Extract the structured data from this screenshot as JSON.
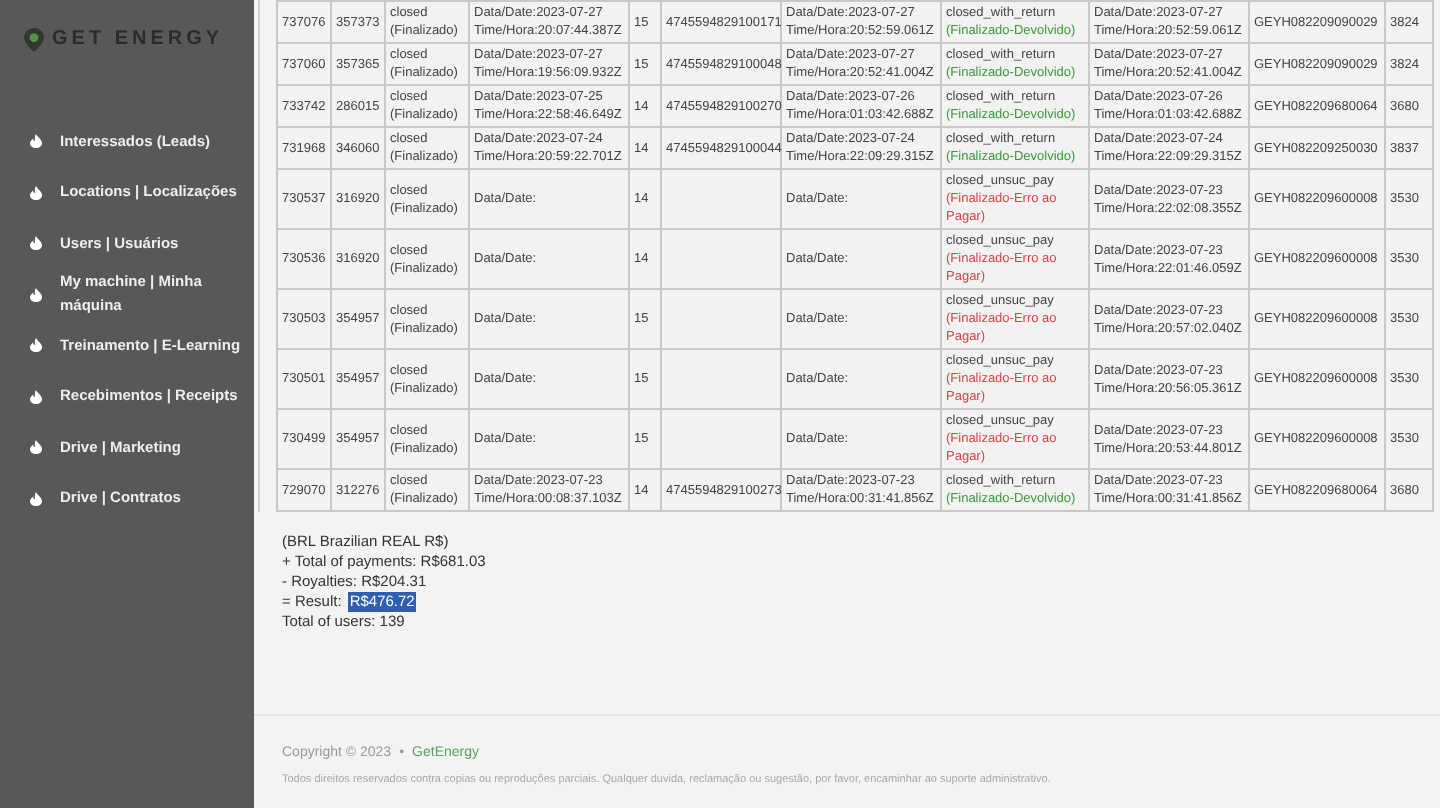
{
  "sidebar": {
    "logo": "GET ENERGY",
    "items": [
      {
        "label": "Interessados (Leads)"
      },
      {
        "label": "Locations | Localizações"
      },
      {
        "label": "Users | Usuários"
      },
      {
        "label": "My machine | Minha máquina"
      },
      {
        "label": "Treinamento | E-Learning"
      },
      {
        "label": "Recebimentos | Receipts"
      },
      {
        "label": "Drive | Marketing"
      },
      {
        "label": "Drive | Contratos"
      }
    ]
  },
  "table": {
    "rows": [
      {
        "id": "737076",
        "user": "357373",
        "status": "closed",
        "status_label": "(Finalizado)",
        "date": [
          "Data/Date:2023-07-27",
          "Time/Hora:20:07:44.387Z"
        ],
        "count": "15",
        "card": "4745594829100171",
        "date_2": [
          "Data/Date:2023-07-27",
          "Time/Hora:20:52:59.061Z"
        ],
        "result": {
          "kind": "returned",
          "code": "closed_with_return",
          "label": "(Finalizado-Devolvido)"
        },
        "date_3": [
          "Data/Date:2023-07-27",
          "Time/Hora:20:52:59.061Z"
        ],
        "serial": "GEYH082209090029",
        "column_11": "3824"
      },
      {
        "id": "737060",
        "user": "357365",
        "status": "closed",
        "status_label": "(Finalizado)",
        "date": [
          "Data/Date:2023-07-27",
          "Time/Hora:19:56:09.932Z"
        ],
        "count": "15",
        "card": "4745594829100048",
        "date_2": [
          "Data/Date:2023-07-27",
          "Time/Hora:20:52:41.004Z"
        ],
        "result": {
          "kind": "returned",
          "code": "closed_with_return",
          "label": "(Finalizado-Devolvido)"
        },
        "date_3": [
          "Data/Date:2023-07-27",
          "Time/Hora:20:52:41.004Z"
        ],
        "serial": "GEYH082209090029",
        "column_11": "3824"
      },
      {
        "id": "733742",
        "user": "286015",
        "status": "closed",
        "status_label": "(Finalizado)",
        "date": [
          "Data/Date:2023-07-25",
          "Time/Hora:22:58:46.649Z"
        ],
        "count": "14",
        "card": "4745594829100270",
        "date_2": [
          "Data/Date:2023-07-26",
          "Time/Hora:01:03:42.688Z"
        ],
        "result": {
          "kind": "returned",
          "code": "closed_with_return",
          "label": "(Finalizado-Devolvido)"
        },
        "date_3": [
          "Data/Date:2023-07-26",
          "Time/Hora:01:03:42.688Z"
        ],
        "serial": "GEYH082209680064",
        "column_11": "3680"
      },
      {
        "id": "731968",
        "user": "346060",
        "status": "closed",
        "status_label": "(Finalizado)",
        "date": [
          "Data/Date:2023-07-24",
          "Time/Hora:20:59:22.701Z"
        ],
        "count": "14",
        "card": "4745594829100044",
        "date_2": [
          "Data/Date:2023-07-24",
          "Time/Hora:22:09:29.315Z"
        ],
        "result": {
          "kind": "returned",
          "code": "closed_with_return",
          "label": "(Finalizado-Devolvido)"
        },
        "date_3": [
          "Data/Date:2023-07-24",
          "Time/Hora:22:09:29.315Z"
        ],
        "serial": "GEYH082209250030",
        "column_11": "3837"
      },
      {
        "id": "730537",
        "user": "316920",
        "status": "closed",
        "status_label": "(Finalizado)",
        "date": [
          "Data/Date:"
        ],
        "count": "14",
        "date_2": [
          "Data/Date:"
        ],
        "result": {
          "kind": "failed",
          "code": "closed_unsuc_pay",
          "label": "(Finalizado-Erro ao Pagar)"
        },
        "date_3": [
          "Data/Date:2023-07-23",
          "Time/Hora:22:02:08.355Z"
        ],
        "serial": "GEYH082209600008",
        "column_11": "3530"
      },
      {
        "id": "730536",
        "user": "316920",
        "status": "closed",
        "status_label": "(Finalizado)",
        "date": [
          "Data/Date:"
        ],
        "count": "14",
        "date_2": [
          "Data/Date:"
        ],
        "result": {
          "kind": "failed",
          "code": "closed_unsuc_pay",
          "label": "(Finalizado-Erro ao Pagar)"
        },
        "date_3": [
          "Data/Date:2023-07-23",
          "Time/Hora:22:01:46.059Z"
        ],
        "serial": "GEYH082209600008",
        "column_11": "3530"
      },
      {
        "id": "730503",
        "user": "354957",
        "status": "closed",
        "status_label": "(Finalizado)",
        "date": [
          "Data/Date:"
        ],
        "count": "15",
        "date_2": [
          "Data/Date:"
        ],
        "result": {
          "kind": "failed",
          "code": "closed_unsuc_pay",
          "label": "(Finalizado-Erro ao Pagar)"
        },
        "date_3": [
          "Data/Date:2023-07-23",
          "Time/Hora:20:57:02.040Z"
        ],
        "serial": "GEYH082209600008",
        "column_11": "3530"
      },
      {
        "id": "730501",
        "user": "354957",
        "status": "closed",
        "status_label": "(Finalizado)",
        "date": [
          "Data/Date:"
        ],
        "count": "15",
        "date_2": [
          "Data/Date:"
        ],
        "result": {
          "kind": "failed",
          "code": "closed_unsuc_pay",
          "label": "(Finalizado-Erro ao Pagar)"
        },
        "date_3": [
          "Data/Date:2023-07-23",
          "Time/Hora:20:56:05.361Z"
        ],
        "serial": "GEYH082209600008",
        "column_11": "3530"
      },
      {
        "id": "730499",
        "user": "354957",
        "status": "closed",
        "status_label": "(Finalizado)",
        "date": [
          "Data/Date:"
        ],
        "count": "15",
        "date_2": [
          "Data/Date:"
        ],
        "result": {
          "kind": "failed",
          "code": "closed_unsuc_pay",
          "label": "(Finalizado-Erro ao Pagar)"
        },
        "date_3": [
          "Data/Date:2023-07-23",
          "Time/Hora:20:53:44.801Z"
        ],
        "serial": "GEYH082209600008",
        "column_11": "3530"
      },
      {
        "id": "729070",
        "user": "312276",
        "status": "closed",
        "status_label": "(Finalizado)",
        "date": [
          "Data/Date:2023-07-23",
          "Time/Hora:00:08:37.103Z"
        ],
        "count": "14",
        "card": "4745594829100273",
        "date_2": [
          "Data/Date:2023-07-23",
          "Time/Hora:00:31:41.856Z"
        ],
        "result": {
          "kind": "returned",
          "code": "closed_with_return",
          "label": "(Finalizado-Devolvido)"
        },
        "date_3": [
          "Data/Date:2023-07-23",
          "Time/Hora:00:31:41.856Z"
        ],
        "serial": "GEYH082209680064",
        "column_11": "3680"
      }
    ]
  },
  "summary": {
    "lines": [
      "(BRL Brazilian REAL R$)",
      "+ Total of payments: R$681.03",
      "- Royalties: R$204.31"
    ],
    "result": {
      "label": "= Result:",
      "value": "R$476.72",
      "highlighted": true
    },
    "users": "Total of users: 139"
  },
  "footer": {
    "copyright": "Copyright © 2023",
    "separator": "•",
    "brand": "GetEnergy",
    "notice": "Todos direitos reservados contra copias ou reproduções parciais. Qualquer duvida, reclamação ou sugestão, por favor, encaminhar ao suporte administrativo."
  }
}
